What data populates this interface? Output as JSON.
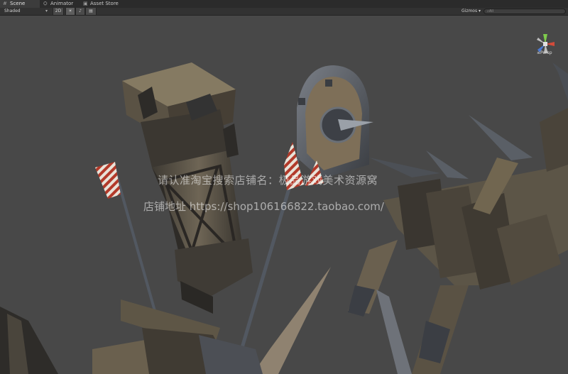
{
  "tabs": [
    {
      "label": "Scene",
      "icon": "scene-icon",
      "active": true
    },
    {
      "label": "Animator",
      "icon": "animator-icon",
      "active": false
    },
    {
      "label": "Asset Store",
      "icon": "store-icon",
      "active": false
    }
  ],
  "toolbar": {
    "shading": "Shaded",
    "mode_2d": "2D",
    "gizmos": "Gizmos",
    "search_placeholder": "All"
  },
  "gizmo": {
    "projection": "Persp"
  },
  "watermark": {
    "line1": "请认准淘宝搜索店铺名：极品游戏美术资源窝",
    "line2": "店铺地址 https://shop106166822.taobao.com/"
  },
  "colors": {
    "viewport_bg": "#484848",
    "wood": "#7a6a52",
    "metal": "#5e636a"
  }
}
